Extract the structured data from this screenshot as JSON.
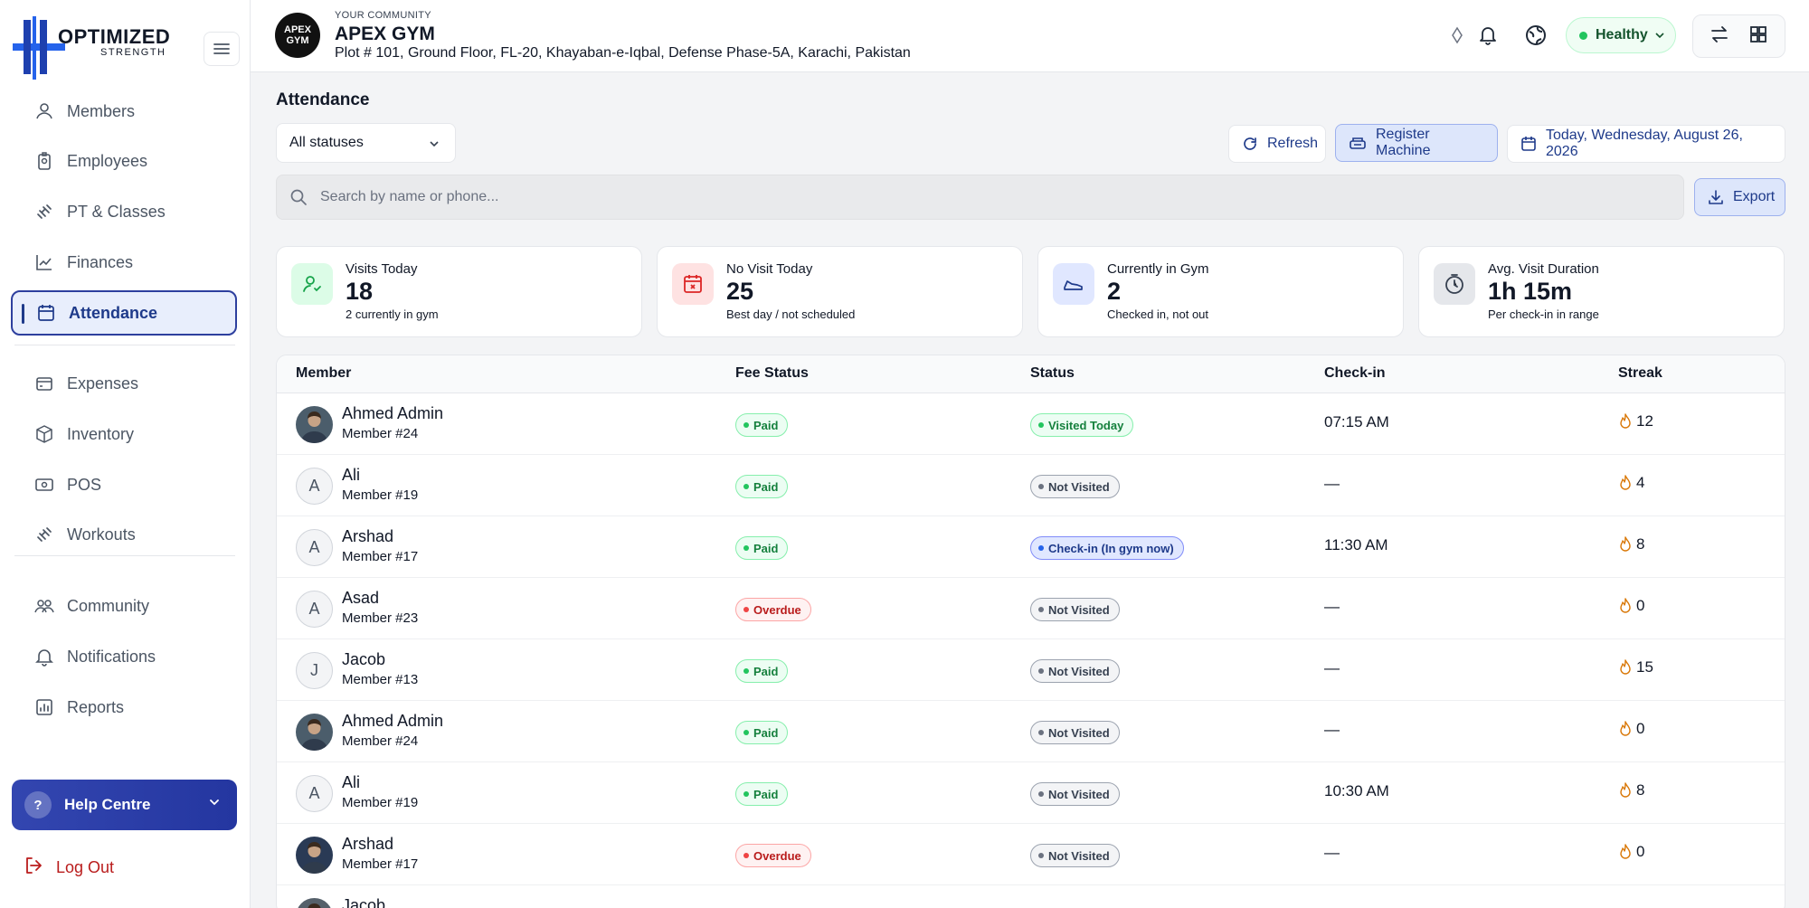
{
  "brand": {
    "line1": "OPTIMIZED",
    "line2": "STRENGTH"
  },
  "sidebar": {
    "items": [
      {
        "label": "Members",
        "icon": "members-icon"
      },
      {
        "label": "Employees",
        "icon": "badge-icon"
      },
      {
        "label": "PT & Classes",
        "icon": "dumbbell-icon"
      },
      {
        "label": "Finances",
        "icon": "chart-line-icon"
      },
      {
        "label": "Attendance",
        "icon": "calendar-icon",
        "active": true
      },
      {
        "label": "Expenses",
        "icon": "wallet-icon"
      },
      {
        "label": "Inventory",
        "icon": "box-icon"
      },
      {
        "label": "POS",
        "icon": "cash-icon"
      },
      {
        "label": "Workouts",
        "icon": "dumbbell-icon"
      },
      {
        "label": "Community",
        "icon": "community-icon"
      },
      {
        "label": "Notifications",
        "icon": "bell-icon"
      },
      {
        "label": "Reports",
        "icon": "report-icon"
      }
    ],
    "help": "Help Centre",
    "help_icon": "?",
    "logout": "Log Out"
  },
  "header": {
    "gym_logo": "APEX GYM",
    "community_label": "YOUR COMMUNITY",
    "gym_name": "APEX GYM",
    "address": "Plot # 101, Ground Floor, FL-20, Khayaban-e-Iqbal, Defense Phase-5A, Karachi, Pakistan",
    "health": "Healthy"
  },
  "main": {
    "title": "Attendance",
    "status_filter": "All statuses",
    "refresh": "Refresh",
    "register": "Register Machine",
    "date": "Today, Wednesday, August 26, 2026",
    "search_placeholder": "Search by name or phone...",
    "export": "Export"
  },
  "stats": [
    {
      "label": "Visits Today",
      "value": "18",
      "sub": "2 currently in gym",
      "color": "#dcfce7",
      "icon": "user-check-icon"
    },
    {
      "label": "No Visit Today",
      "value": "25",
      "sub": "Best day / not scheduled",
      "color": "#fee2e2",
      "icon": "calendar-x-icon"
    },
    {
      "label": "Currently in Gym",
      "value": "2",
      "sub": "Checked in, not out",
      "color": "#e0e7ff",
      "icon": "shoe-icon"
    },
    {
      "label": "Avg. Visit Duration",
      "value": "1h 15m",
      "sub": "Per check-in in range",
      "color": "#e5e7eb",
      "icon": "timer-icon"
    }
  ],
  "table": {
    "headers": [
      "Member",
      "Fee Status",
      "Status",
      "Check-in",
      "Streak"
    ],
    "rows": [
      {
        "name": "Ahmed Admin",
        "id": "Member #24",
        "initial": "",
        "photo": true,
        "fee": "Paid",
        "status": "Visited Today",
        "checkin": "07:15 AM",
        "streak": "12"
      },
      {
        "name": "Ali",
        "id": "Member #19",
        "initial": "A",
        "photo": false,
        "fee": "Paid",
        "status": "Not Visited",
        "checkin": "—",
        "streak": "4"
      },
      {
        "name": "Arshad",
        "id": "Member #17",
        "initial": "A",
        "photo": false,
        "fee": "Paid",
        "status": "Check-in (In gym now)",
        "checkin": "11:30 AM",
        "streak": "8"
      },
      {
        "name": "Asad",
        "id": "Member #23",
        "initial": "A",
        "photo": false,
        "fee": "Overdue",
        "status": "Not Visited",
        "checkin": "—",
        "streak": "0"
      },
      {
        "name": "Jacob",
        "id": "Member #13",
        "initial": "J",
        "photo": false,
        "fee": "Paid",
        "status": "Not Visited",
        "checkin": "—",
        "streak": "15"
      },
      {
        "name": "Ahmed Admin",
        "id": "Member #24",
        "initial": "",
        "photo": true,
        "fee": "Paid",
        "status": "Not Visited",
        "checkin": "—",
        "streak": "0"
      },
      {
        "name": "Ali",
        "id": "Member #19",
        "initial": "A",
        "photo": false,
        "fee": "Paid",
        "status": "Not Visited",
        "checkin": "10:30 AM",
        "streak": "8"
      },
      {
        "name": "Arshad",
        "id": "Member #17",
        "initial": "",
        "photo": true,
        "fee": "Overdue",
        "status": "Not Visited",
        "checkin": "—",
        "streak": "0"
      },
      {
        "name": "Jacob",
        "id": "",
        "initial": "",
        "photo": true,
        "fee": "",
        "status": "",
        "checkin": "",
        "streak": ""
      }
    ]
  }
}
